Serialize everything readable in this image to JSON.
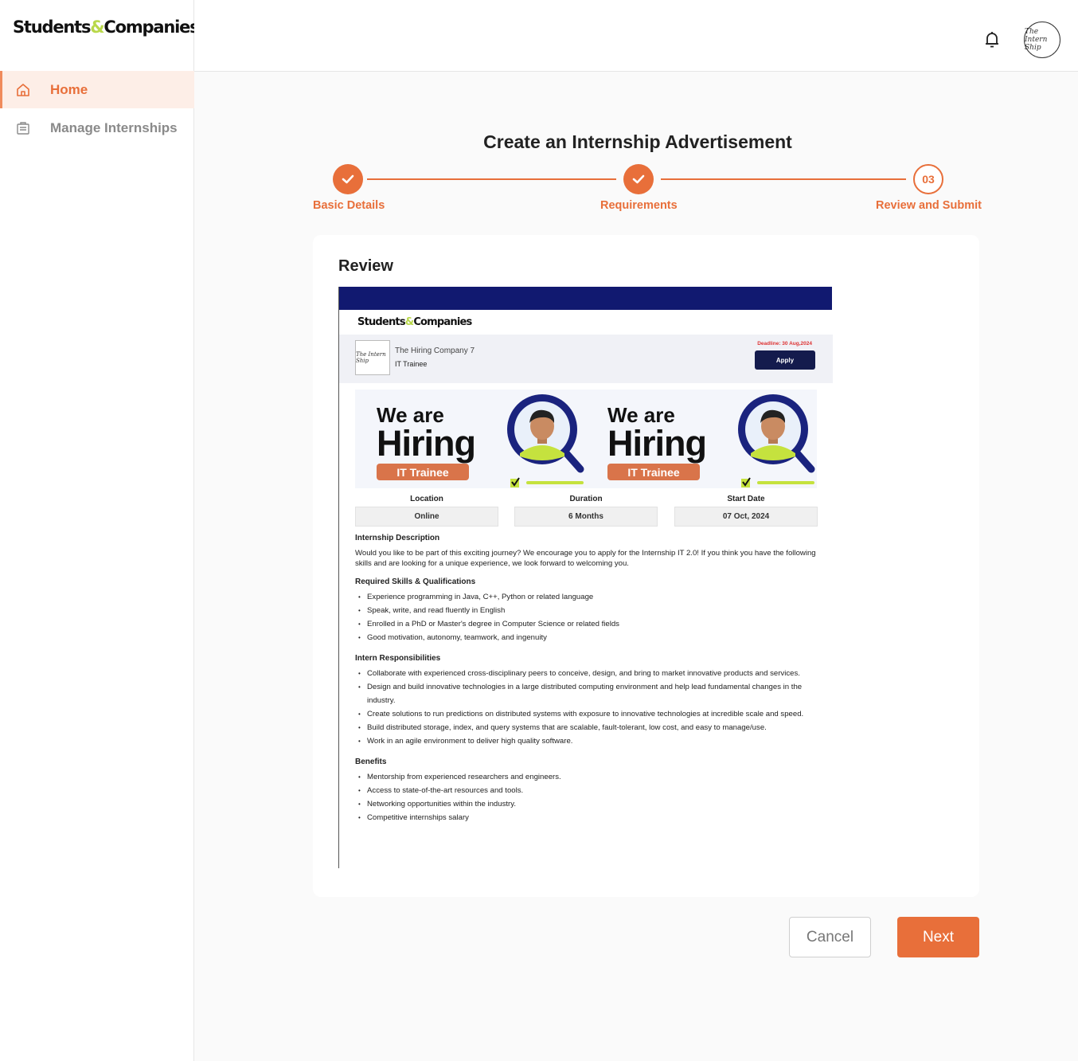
{
  "app": {
    "logo_left": "Students",
    "logo_amp": "&",
    "logo_right": "Companies",
    "brand_color": "#e86f3a"
  },
  "sidebar": {
    "items": [
      {
        "label": "Home",
        "icon": "home-icon",
        "active": true
      },
      {
        "label": "Manage Internships",
        "icon": "briefcase-icon",
        "active": false
      }
    ]
  },
  "header": {
    "notification_icon": "bell-icon",
    "avatar_text": "The Intern Ship"
  },
  "page": {
    "title": "Create an Internship Advertisement"
  },
  "stepper": {
    "steps": [
      {
        "label": "Basic Details",
        "state": "completed"
      },
      {
        "label": "Requirements",
        "state": "completed"
      },
      {
        "label": "Review and Submit",
        "number": "03",
        "state": "current"
      }
    ]
  },
  "review": {
    "title": "Review",
    "preview": {
      "logo_left": "Students",
      "logo_amp": "&",
      "logo_right": "Companies",
      "company_logo_text": "The Intern Ship",
      "company_name": "The Hiring Company 7",
      "role": "IT Trainee",
      "deadline": "Deadline: 30 Aug,2024",
      "apply_label": "Apply",
      "banner": {
        "line1": "We are",
        "line2": "Hiring",
        "tag": "IT Trainee"
      },
      "meta": [
        {
          "label": "Location",
          "value": "Online"
        },
        {
          "label": "Duration",
          "value": "6 Months"
        },
        {
          "label": "Start Date",
          "value": "07 Oct, 2024"
        }
      ],
      "description_title": "Internship Description",
      "description": "Would you like to be part of this exciting journey? We encourage you to apply for the Internship IT 2.0! If you think you have the following skills and are looking for a unique experience, we look forward to welcoming you.",
      "skills_title": "Required Skills & Qualifications",
      "skills": [
        " Experience programming in Java, C++, Python or related language",
        " Speak, write, and read fluently in English",
        " Enrolled in a PhD or Master's degree in Computer Science or related fields",
        "Good motivation, autonomy, teamwork, and ingenuity"
      ],
      "responsibilities_title": "Intern Responsibilities",
      "responsibilities": [
        "Collaborate with experienced cross-disciplinary peers to conceive, design, and bring to market innovative products and services.",
        "Design and build innovative technologies in a large distributed computing environment and help lead fundamental changes in the industry.",
        "Create solutions to run predictions on distributed systems with exposure to innovative technologies at incredible scale and speed.",
        " Build distributed storage, index, and query systems that are scalable, fault-tolerant, low cost, and easy to manage/use.",
        "Work in an agile environment to deliver high quality software."
      ],
      "benefits_title": "Benefits",
      "benefits": [
        "Mentorship from experienced researchers and engineers.",
        "Access to state-of-the-art resources and tools.",
        "Networking opportunities within the industry.",
        "Competitive internships salary"
      ]
    }
  },
  "actions": {
    "cancel_label": "Cancel",
    "next_label": "Next"
  }
}
